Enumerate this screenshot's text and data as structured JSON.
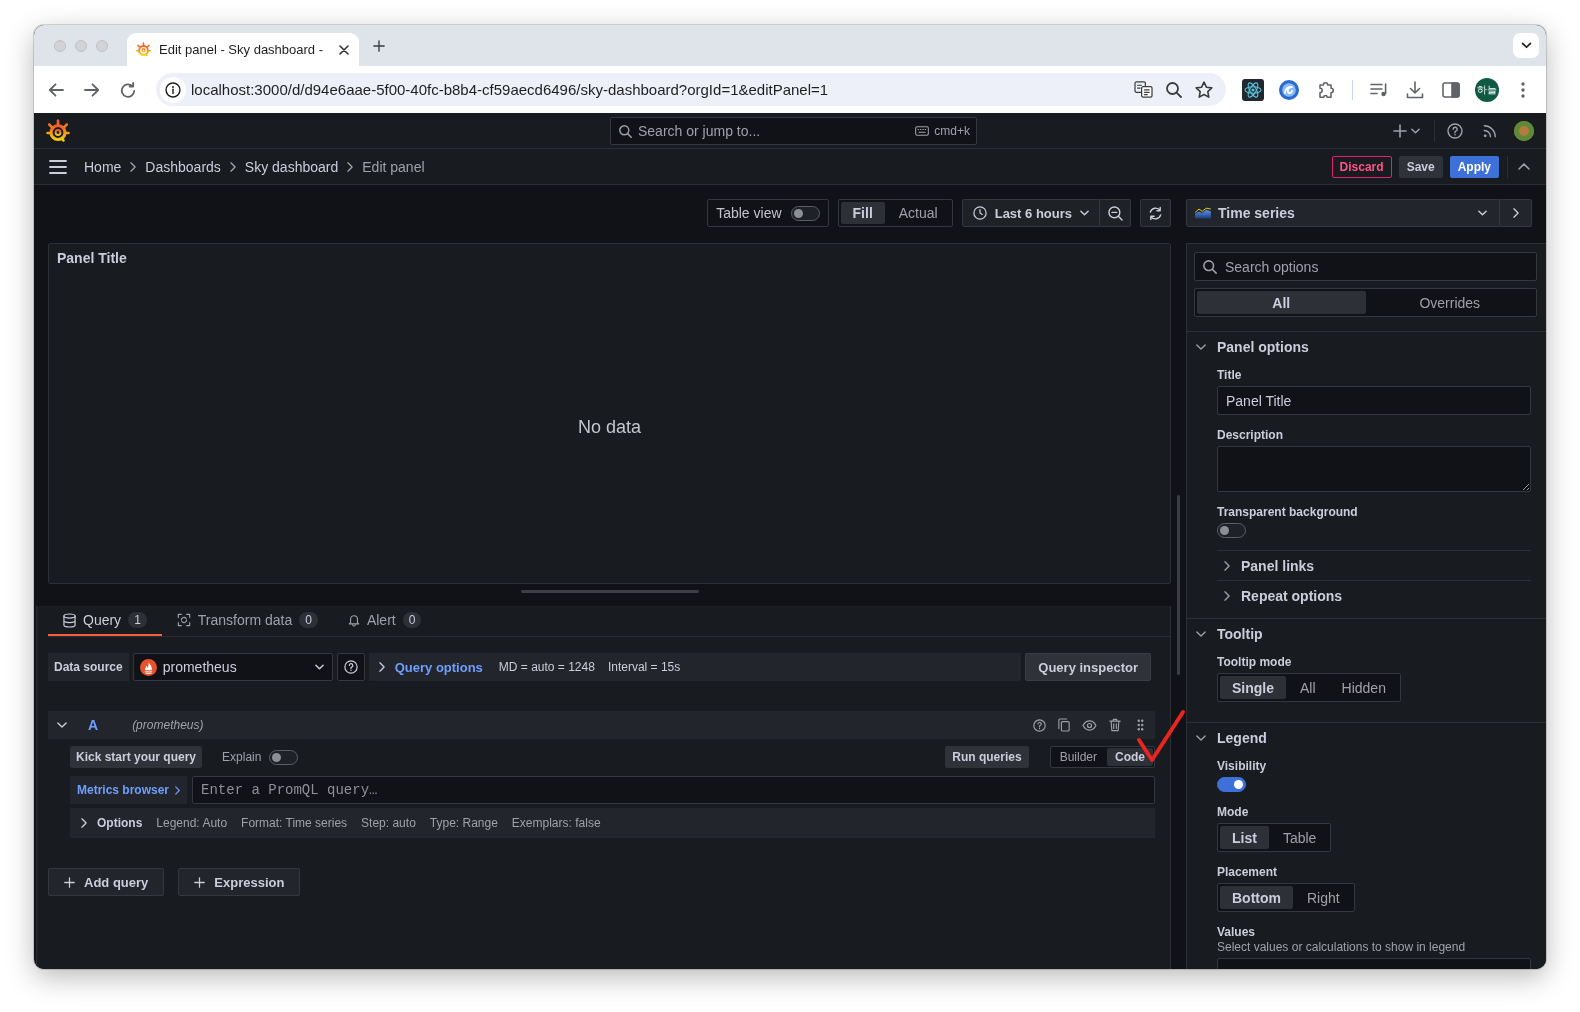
{
  "browser": {
    "tabs": [
      {
        "title": "Edit panel - Sky dashboard -",
        "selected": true
      }
    ],
    "address": "localhost:3000/d/d94e6aae-5f00-40fc-b8b4-cf59aecd6496/sky-dashboard?orgId=1&editPanel=1",
    "profile": "하늘"
  },
  "topbar": {
    "search": {
      "placeholder": "Search or jump to..."
    },
    "shortcut": "cmd+k"
  },
  "breadcrumbs": [
    {
      "label": "Home",
      "current": false
    },
    {
      "label": "Dashboards",
      "current": false
    },
    {
      "label": "Sky dashboard",
      "current": false
    },
    {
      "label": "Edit panel",
      "current": true
    }
  ],
  "actions": [
    {
      "label": "Discard",
      "kind": "destructive"
    },
    {
      "label": "Save",
      "kind": "secondary"
    },
    {
      "label": "Apply",
      "kind": "primary"
    }
  ],
  "toolbar": {
    "table_view": {
      "label": "Table view",
      "on": false
    },
    "size_modes": [
      {
        "label": "Fill",
        "selected": true
      },
      {
        "label": "Actual",
        "selected": false
      }
    ],
    "time_range": "Last 6 hours"
  },
  "panel": {
    "title": "Panel Title",
    "message": "No data"
  },
  "query_tabs": [
    {
      "label": "Query",
      "count": "1",
      "selected": true
    },
    {
      "label": "Transform data",
      "count": "0",
      "selected": false
    },
    {
      "label": "Alert",
      "count": "0",
      "selected": false
    }
  ],
  "query_bar": {
    "data_source_label": "Data source",
    "data_source": "prometheus",
    "options_label": "Query options",
    "details": [
      "MD = auto = 1248",
      "Interval = 15s"
    ],
    "inspector": "Query inspector"
  },
  "queries": [
    {
      "ref": "A",
      "source": "(prometheus)",
      "expanded": true,
      "kick_start": "Kick start your query",
      "explain": {
        "label": "Explain",
        "on": false
      },
      "run": "Run queries",
      "modes": [
        {
          "label": "Builder",
          "selected": false
        },
        {
          "label": "Code",
          "selected": true
        }
      ],
      "metrics_browser": "Metrics browser",
      "input": {
        "placeholder": "Enter a PromQL query…"
      },
      "options": {
        "label": "Options",
        "expanded": false,
        "details": [
          "Legend: Auto",
          "Format: Time series",
          "Step: auto",
          "Type: Range",
          "Exemplars: false"
        ]
      }
    }
  ],
  "add_buttons": [
    "Add query",
    "Expression"
  ],
  "options_pane": {
    "visualization": "Time series",
    "search": {
      "placeholder": "Search options"
    },
    "tabs": [
      {
        "label": "All",
        "selected": true
      },
      {
        "label": "Overrides",
        "selected": false
      }
    ],
    "sections": [
      {
        "title": "Panel options",
        "expanded": true,
        "items": [
          {
            "kind": "text",
            "label": "Title",
            "value": "Panel Title"
          },
          {
            "kind": "textarea",
            "label": "Description"
          },
          {
            "kind": "switch",
            "label": "Transparent background",
            "on": false
          },
          {
            "kind": "group",
            "label": "Panel links",
            "expanded": false
          },
          {
            "kind": "group",
            "label": "Repeat options",
            "expanded": false
          }
        ]
      },
      {
        "title": "Tooltip",
        "expanded": true,
        "items": [
          {
            "kind": "radio",
            "label": "Tooltip mode",
            "options": [
              {
                "label": "Single",
                "selected": true
              },
              {
                "label": "All",
                "selected": false
              },
              {
                "label": "Hidden",
                "selected": false
              }
            ]
          }
        ]
      },
      {
        "title": "Legend",
        "expanded": true,
        "items": [
          {
            "kind": "switch",
            "label": "Visibility",
            "on": true
          },
          {
            "kind": "radio",
            "label": "Mode",
            "options": [
              {
                "label": "List",
                "selected": true
              },
              {
                "label": "Table",
                "selected": false
              }
            ]
          },
          {
            "kind": "radio",
            "label": "Placement",
            "options": [
              {
                "label": "Bottom",
                "selected": true
              },
              {
                "label": "Right",
                "selected": false
              }
            ]
          },
          {
            "kind": "select",
            "label": "Values",
            "description": "Select values or calculations to show in legend"
          }
        ]
      }
    ]
  },
  "annotations": [
    {
      "kind": "tick"
    }
  ]
}
